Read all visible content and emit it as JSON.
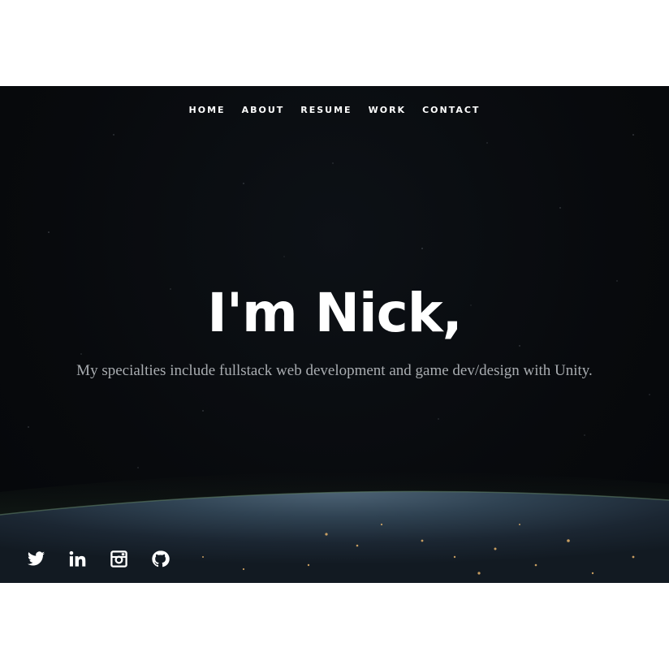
{
  "nav": {
    "items": [
      {
        "label": "HOME"
      },
      {
        "label": "ABOUT"
      },
      {
        "label": "RESUME"
      },
      {
        "label": "WORK"
      },
      {
        "label": "CONTACT"
      }
    ]
  },
  "hero": {
    "title": "I'm Nick,",
    "subtitle": "My specialties include fullstack web development and game dev/design with Unity."
  },
  "social": {
    "icons": [
      "twitter-icon",
      "linkedin-icon",
      "instagram-icon",
      "github-icon"
    ]
  },
  "colors": {
    "background": "#080a0d",
    "text": "#ffffff",
    "subtitle": "#a8acb0",
    "page": "#ffffff"
  }
}
